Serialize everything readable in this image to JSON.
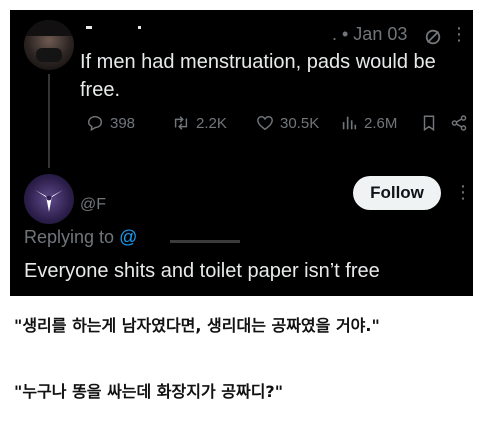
{
  "tweet": {
    "author_name": "",
    "date": ". • Jan 03",
    "text": "If men had menstruation, pads would be free.",
    "replies": "398",
    "retweets": "2.2K",
    "likes": "30.5K",
    "views": "2.6M",
    "icons": [
      "grok-icon",
      "more-icon",
      "reply-icon",
      "retweet-icon",
      "like-icon",
      "views-icon",
      "bookmark-icon",
      "share-icon"
    ]
  },
  "reply": {
    "handle": "@F",
    "follow_label": "Follow",
    "replying_prefix": "Replying to ",
    "replying_user": "@",
    "text": "Everyone shits and toilet paper isn’t free"
  },
  "captions": {
    "line1": "\"생리를 하는게 남자였다면, 생리대는 공짜였을 거야.\"",
    "line2": "\"누구나 똥을 싸는데 화장지가 공짜디?\""
  },
  "colors": {
    "background": "#000000",
    "text": "#e7e9ea",
    "muted": "#71767b",
    "link": "#1d9bf0",
    "follow_bg": "#eff3f4"
  }
}
